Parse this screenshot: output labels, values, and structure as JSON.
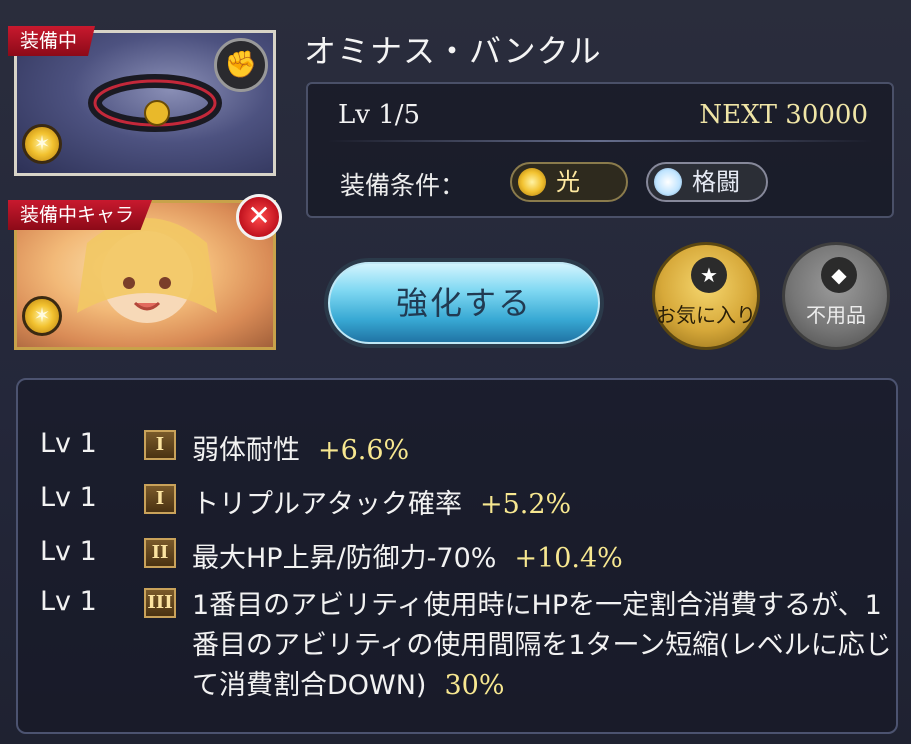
{
  "item": {
    "name": "オミナス・バンクル",
    "equipped_badge": "装備中",
    "level_text": "Lv 1/5",
    "next_label": "NEXT",
    "next_value": "30000",
    "condition_label": "装備条件：",
    "conditions": [
      {
        "label": "光",
        "icon": "light-element-icon"
      },
      {
        "label": "格闘",
        "icon": "fist-weapon-icon"
      }
    ]
  },
  "character": {
    "equipped_badge": "装備中キャラ",
    "remove_icon": "close-icon"
  },
  "actions": {
    "upgrade_label": "強化する",
    "favorite_label": "お気に入り",
    "junk_label": "不用品"
  },
  "skills": [
    {
      "lv": "Lv 1",
      "rank": "I",
      "name": "弱体耐性",
      "value": "+6.6%"
    },
    {
      "lv": "Lv 1",
      "rank": "I",
      "name": "トリプルアタック確率",
      "value": "+5.2%"
    },
    {
      "lv": "Lv 1",
      "rank": "II",
      "name": "最大HP上昇/防御力-70%",
      "value": "+10.4%"
    },
    {
      "lv": "Lv 1",
      "rank": "III",
      "name": "1番目のアビリティ使用時にHPを一定割合消費するが、1番目のアビリティの使用間隔を1ターン短縮(レベルに応じて消費割合DOWN)",
      "value": "30%"
    }
  ]
}
